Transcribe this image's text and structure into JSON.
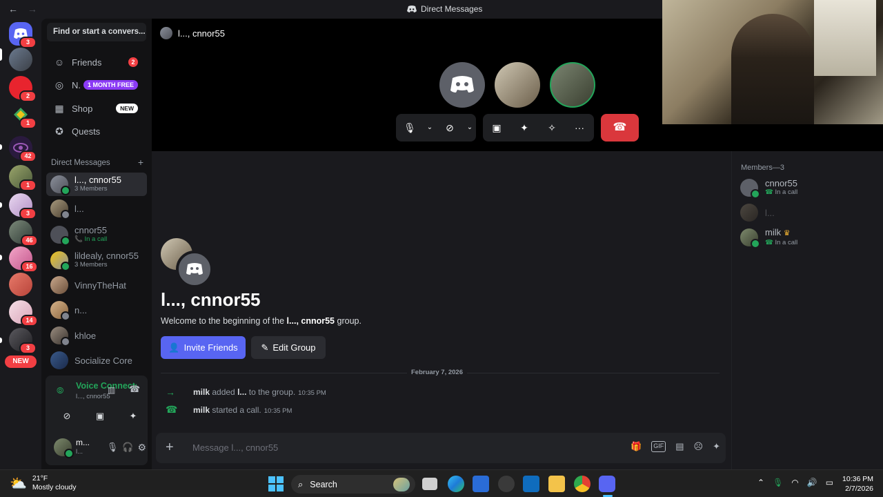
{
  "titlebar": {
    "back": "←",
    "forward": "→",
    "title": "Direct Messages"
  },
  "rail": {
    "badges": [
      "3",
      "2",
      "1",
      "42",
      "1",
      "3",
      "46",
      "16",
      "14",
      "3"
    ],
    "new_label": "NEW"
  },
  "sidebar": {
    "find_placeholder": "Find or start a convers...",
    "friends_label": "Friends",
    "friends_count": "2",
    "nitro_label": "N.",
    "nitro_promo": "1 MONTH FREE",
    "shop_label": "Shop",
    "shop_tag": "NEW",
    "quests_label": "Quests",
    "dm_header": "Direct Messages",
    "dm_add": "+",
    "dms": [
      {
        "name": "l..., cnnor55",
        "sub": "3 Members"
      },
      {
        "name": "l...",
        "sub": ""
      },
      {
        "name": "cnnor55",
        "sub": "📞 In a call"
      },
      {
        "name": "lildealy, cnnor55",
        "sub": "3 Members"
      },
      {
        "name": "VinnyTheHat",
        "sub": ""
      },
      {
        "name": "n...",
        "sub": ""
      },
      {
        "name": "khloe",
        "sub": ""
      },
      {
        "name": "Socialize Core",
        "sub": ""
      }
    ]
  },
  "voice": {
    "status": "Voice Connected",
    "channel": "l..., cnnor55",
    "user_name": "m...",
    "user_sub": "l..."
  },
  "call": {
    "title": "l..., cnnor55"
  },
  "chat": {
    "group_name": "l..., cnnor55",
    "welcome_pre": "Welcome to the beginning of the",
    "welcome_group": "l..., cnnor55",
    "welcome_post": "group.",
    "invite_label": "Invite Friends",
    "edit_label": "Edit Group",
    "date": "February 7, 2026",
    "messages": [
      {
        "actor": "milk",
        "action": "added",
        "target": "l...",
        "rest": "to the group.",
        "time": "10:35 PM"
      },
      {
        "actor": "milk",
        "action": "started a call.",
        "time": "10:35 PM"
      }
    ],
    "composer_placeholder": "Message l..., cnnor55"
  },
  "members": {
    "header": "Members—3",
    "list": [
      {
        "name": "cnnor55",
        "sub": "In a call"
      },
      {
        "name": "l...",
        "sub": ""
      },
      {
        "name": "milk",
        "crown": "♛",
        "sub": "In a call"
      }
    ]
  },
  "taskbar": {
    "temp": "21°F",
    "condition": "Mostly cloudy",
    "search_label": "Search",
    "time": "10:36 PM",
    "date": "2/7/2026"
  }
}
